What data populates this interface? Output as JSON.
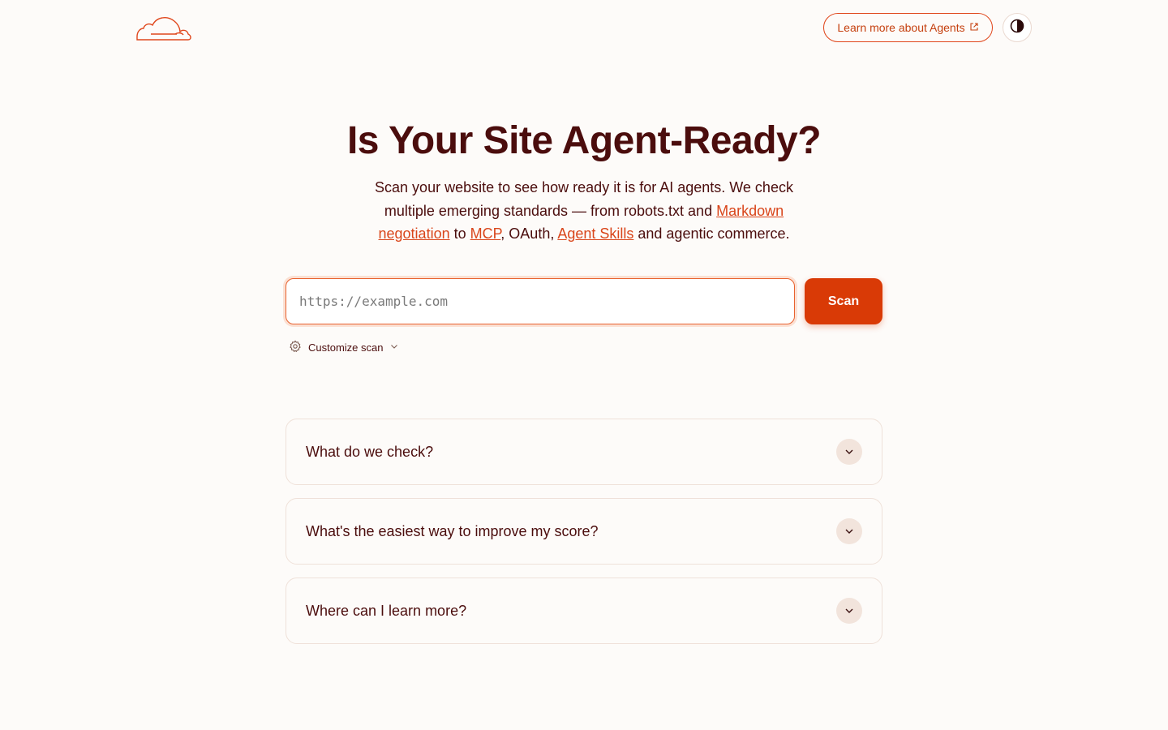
{
  "header": {
    "logo_icon": "cloudflare-logo",
    "learn_more_label": "Learn more about Agents",
    "external_icon": "external-link-icon",
    "theme_icon": "contrast-icon"
  },
  "hero": {
    "title": "Is Your Site Agent-Ready?",
    "desc_part1": "Scan your website to see how ready it is for AI agents. We check multiple emerging standards — from robots.txt and ",
    "link_markdown": "Markdown negotiation",
    "desc_part2": " to ",
    "link_mcp": "MCP",
    "desc_part3": ", OAuth, ",
    "link_skills": "Agent Skills",
    "desc_part4": " and agentic commerce."
  },
  "scan": {
    "placeholder": "https://example.com",
    "button_label": "Scan",
    "customize_label": "Customize scan"
  },
  "faq": [
    {
      "question": "What do we check?"
    },
    {
      "question": "What's the easiest way to improve my score?"
    },
    {
      "question": "Where can I learn more?"
    }
  ],
  "colors": {
    "accent": "#d93a06",
    "text": "#4b0d0d",
    "link": "#d9451a",
    "background": "#fdfbf9"
  }
}
